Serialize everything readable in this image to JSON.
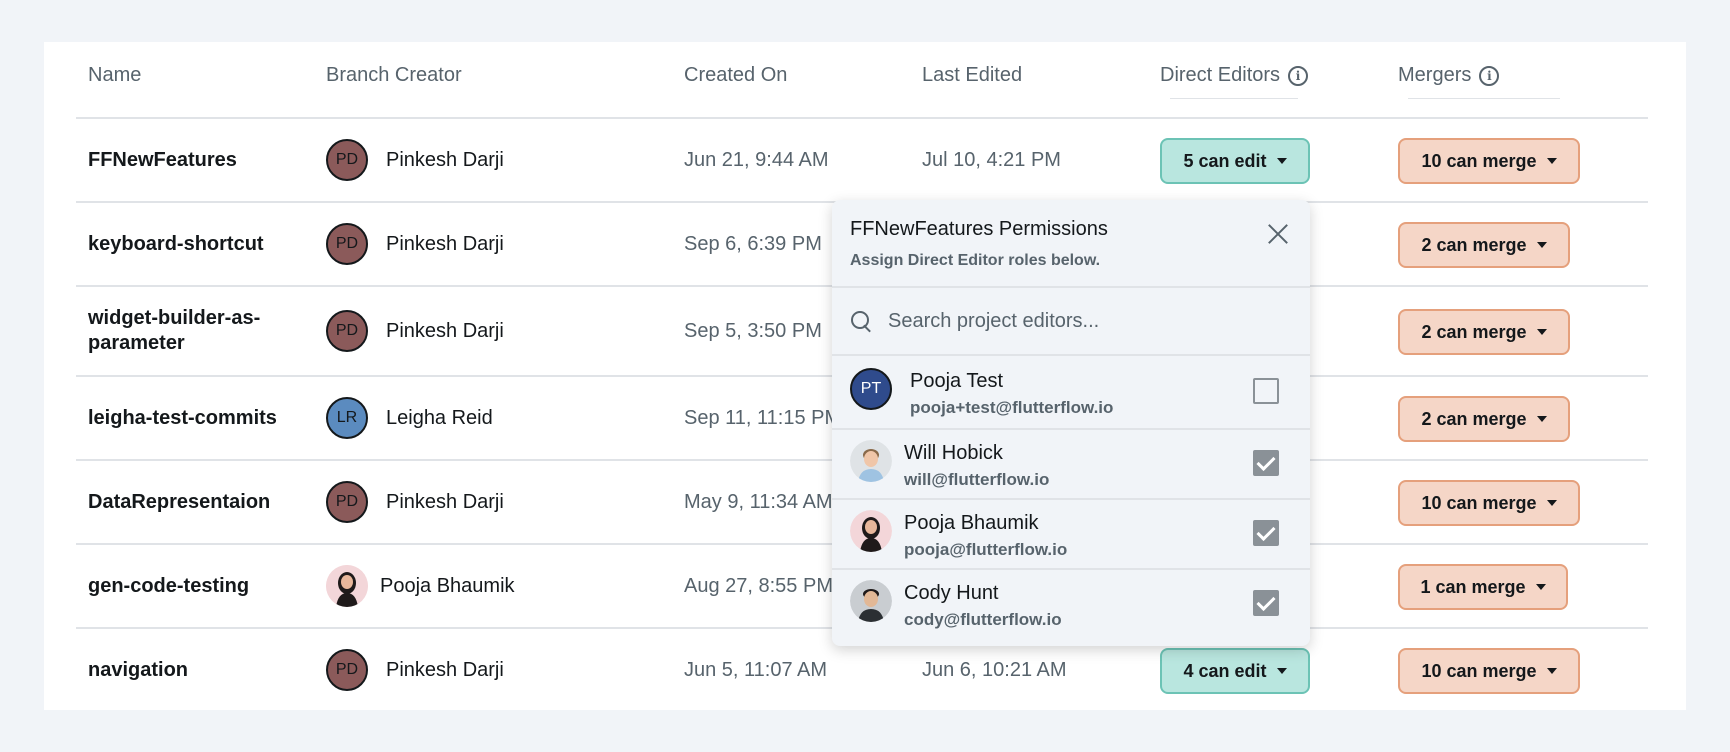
{
  "table": {
    "headers": {
      "name": "Name",
      "creator": "Branch Creator",
      "created": "Created On",
      "edited": "Last Edited",
      "editors": "Direct Editors",
      "mergers": "Mergers"
    },
    "rows": [
      {
        "name": "FFNewFeatures",
        "creator": "Pinkesh Darji",
        "initials": "PD",
        "created": "Jun 21, 9:44 AM",
        "edited": "Jul 10, 4:21 PM",
        "editors": "5 can edit",
        "mergers": "10 can merge"
      },
      {
        "name": "keyboard-shortcut",
        "creator": "Pinkesh Darji",
        "initials": "PD",
        "created": "Sep 6, 6:39 PM",
        "edited": "",
        "editors": "",
        "mergers": "2 can merge"
      },
      {
        "name": "widget-builder-as-parameter",
        "creator": "Pinkesh Darji",
        "initials": "PD",
        "created": "Sep 5, 3:50 PM",
        "edited": "",
        "editors": "",
        "mergers": "2 can merge"
      },
      {
        "name": "leigha-test-commits",
        "creator": "Leigha Reid",
        "initials": "LR",
        "created": "Sep 11, 11:15 PM",
        "edited": "",
        "editors": "",
        "mergers": "2 can merge"
      },
      {
        "name": "DataRepresentaion",
        "creator": "Pinkesh Darji",
        "initials": "PD",
        "created": "May 9, 11:34 AM",
        "edited": "",
        "editors": "",
        "mergers": "10 can merge"
      },
      {
        "name": "gen-code-testing",
        "creator": "Pooja Bhaumik",
        "initials": "",
        "created": "Aug 27, 8:55 PM",
        "edited": "",
        "editors": "",
        "mergers": "1 can merge"
      },
      {
        "name": "navigation",
        "creator": "Pinkesh Darji",
        "initials": "PD",
        "created": "Jun 5, 11:07 AM",
        "edited": "Jun 6, 10:21 AM",
        "editors": "4 can edit",
        "mergers": "10 can merge"
      }
    ]
  },
  "popup": {
    "title": "FFNewFeatures Permissions",
    "subtitle": "Assign Direct Editor roles below.",
    "search_placeholder": "Search project editors...",
    "users": [
      {
        "name": "Pooja Test",
        "email": "pooja+test@flutterflow.io",
        "initials": "PT",
        "checked": false
      },
      {
        "name": "Will Hobick",
        "email": "will@flutterflow.io",
        "initials": "",
        "checked": true
      },
      {
        "name": "Pooja Bhaumik",
        "email": "pooja@flutterflow.io",
        "initials": "",
        "checked": true
      },
      {
        "name": "Cody Hunt",
        "email": "cody@flutterflow.io",
        "initials": "",
        "checked": true
      }
    ]
  },
  "colors": {
    "editor_pill": "#b9e6df",
    "merger_pill": "#f5d6c7",
    "avatar_pd": "#8b5a5a",
    "avatar_lr": "#5b8bbf",
    "avatar_pt": "#2f4b8c"
  }
}
